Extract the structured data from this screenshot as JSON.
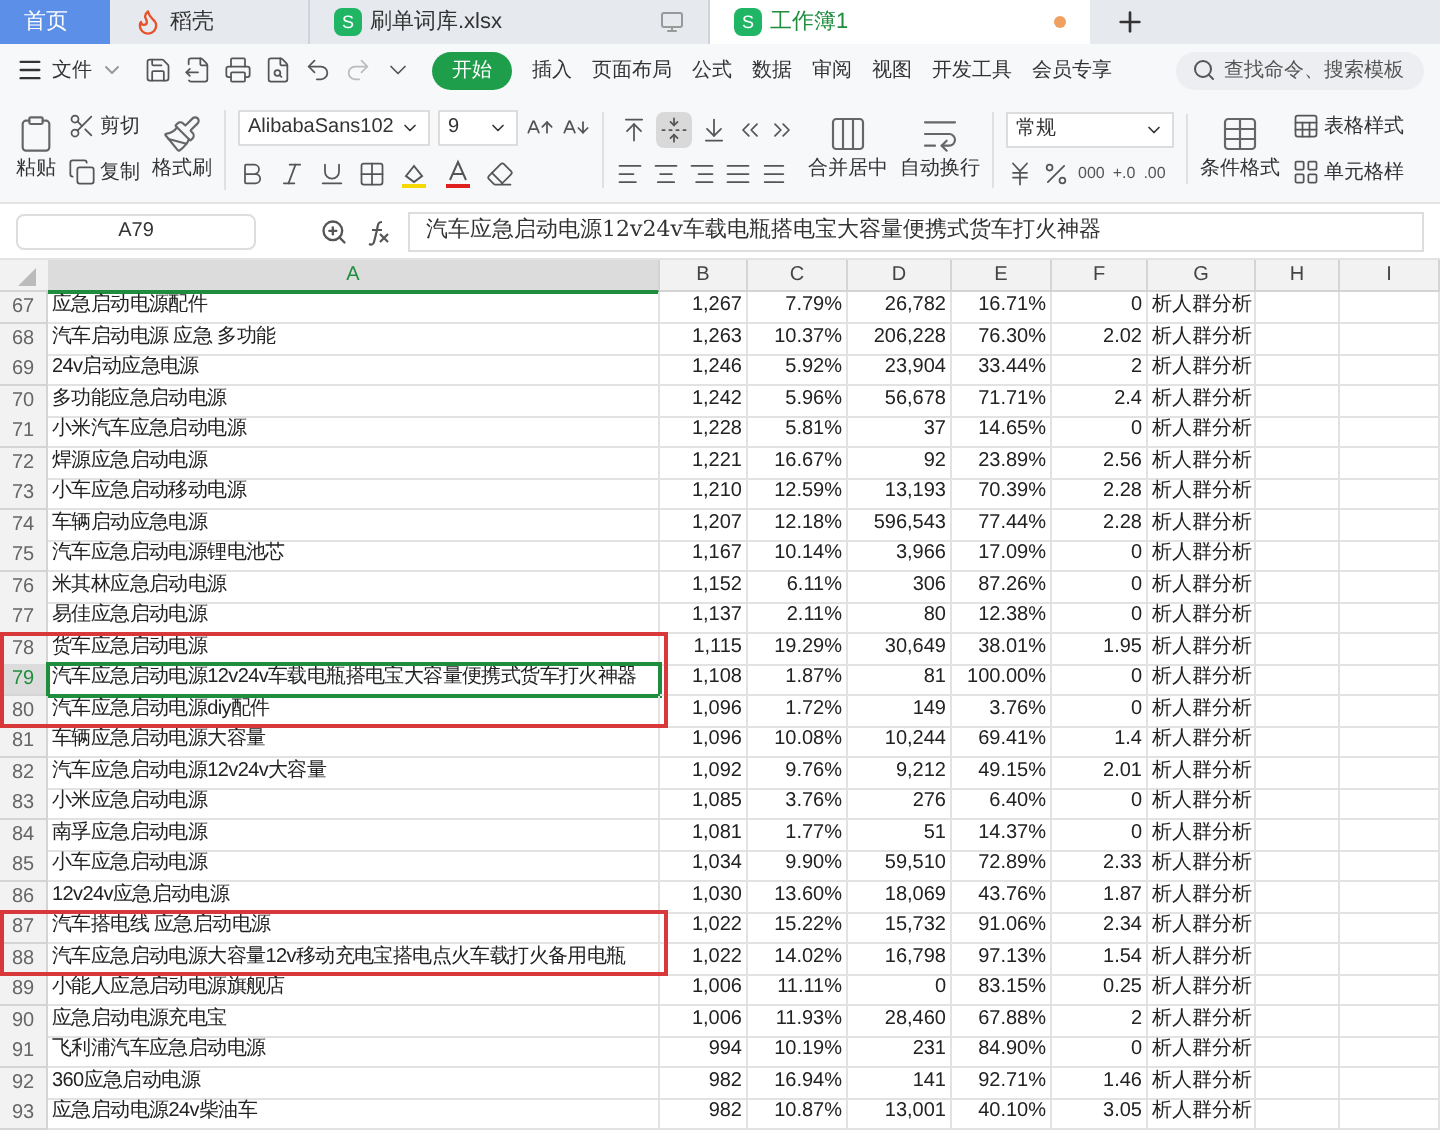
{
  "tabs": [
    {
      "label": "首页",
      "kind": "home",
      "selected": false
    },
    {
      "label": "稻壳",
      "kind": "docer",
      "selected": false
    },
    {
      "label": "刷单词库.xlsx",
      "kind": "sheet",
      "logo": "S",
      "selected": false,
      "unsaved": false
    },
    {
      "label": "工作簿1",
      "kind": "sheet",
      "logo": "S",
      "selected": true,
      "unsaved": true
    }
  ],
  "menu": {
    "file": "文件",
    "items": [
      {
        "label": "开始",
        "selected": true
      },
      {
        "label": "插入",
        "selected": false
      },
      {
        "label": "页面布局",
        "selected": false
      },
      {
        "label": "公式",
        "selected": false
      },
      {
        "label": "数据",
        "selected": false
      },
      {
        "label": "审阅",
        "selected": false
      },
      {
        "label": "视图",
        "selected": false
      },
      {
        "label": "开发工具",
        "selected": false
      },
      {
        "label": "会员专享",
        "selected": false
      }
    ],
    "search": {
      "placeholder": "查找命令、搜索模板"
    }
  },
  "ribbon": {
    "paste": "粘贴",
    "cut": "剪切",
    "copy": "复制",
    "painter": "格式刷",
    "font": "AlibabaSans102",
    "size": "9",
    "align_buttons": [
      {
        "kind": "top",
        "selected": false
      },
      {
        "kind": "middle",
        "selected": true
      },
      {
        "kind": "bottom",
        "selected": false
      }
    ],
    "merge": "合并居中",
    "wrap": "自动换行",
    "number_format": "常规",
    "number_buttons": [
      "000",
      "+.0",
      ".00"
    ],
    "conditional": "条件格式",
    "table_style": "表格样式",
    "cell_style": "单元格样"
  },
  "formula_bar": {
    "cell": "A79",
    "content": "汽车应急启动电源12v24v车载电瓶搭电宝大容量便携式货车打火神器"
  },
  "sheet": {
    "columns": [
      {
        "label": "A",
        "selected": true
      },
      {
        "label": "B",
        "selected": false
      },
      {
        "label": "C",
        "selected": false
      },
      {
        "label": "D",
        "selected": false
      },
      {
        "label": "E",
        "selected": false
      },
      {
        "label": "F",
        "selected": false
      },
      {
        "label": "G",
        "selected": false
      },
      {
        "label": "H",
        "selected": false
      },
      {
        "label": "I",
        "selected": false
      }
    ],
    "rows": [
      {
        "number": "67",
        "selected": false,
        "boxed": false,
        "cells": [
          "应急启动电源配件",
          "1,267",
          "7.79%",
          "26,782",
          "16.71%",
          "0",
          "析人群分析"
        ]
      },
      {
        "number": "68",
        "selected": false,
        "boxed": false,
        "cells": [
          "汽车启动电源 应急 多功能",
          "1,263",
          "10.37%",
          "206,228",
          "76.30%",
          "2.02",
          "析人群分析"
        ]
      },
      {
        "number": "69",
        "selected": false,
        "boxed": false,
        "cells": [
          "24v启动应急电源",
          "1,246",
          "5.92%",
          "23,904",
          "33.44%",
          "2",
          "析人群分析"
        ]
      },
      {
        "number": "70",
        "selected": false,
        "boxed": false,
        "cells": [
          "多功能应急启动电源",
          "1,242",
          "5.96%",
          "56,678",
          "71.71%",
          "2.4",
          "析人群分析"
        ]
      },
      {
        "number": "71",
        "selected": false,
        "boxed": false,
        "cells": [
          "小米汽车应急启动电源",
          "1,228",
          "5.81%",
          "37",
          "14.65%",
          "0",
          "析人群分析"
        ]
      },
      {
        "number": "72",
        "selected": false,
        "boxed": false,
        "cells": [
          "焊源应急启动电源",
          "1,221",
          "16.67%",
          "92",
          "23.89%",
          "2.56",
          "析人群分析"
        ]
      },
      {
        "number": "73",
        "selected": false,
        "boxed": false,
        "cells": [
          "小车应急启动移动电源",
          "1,210",
          "12.59%",
          "13,193",
          "70.39%",
          "2.28",
          "析人群分析"
        ]
      },
      {
        "number": "74",
        "selected": false,
        "boxed": false,
        "cells": [
          "车辆启动应急电源",
          "1,207",
          "12.18%",
          "596,543",
          "77.44%",
          "2.28",
          "析人群分析"
        ]
      },
      {
        "number": "75",
        "selected": false,
        "boxed": false,
        "cells": [
          "汽车应急启动电源锂电池芯",
          "1,167",
          "10.14%",
          "3,966",
          "17.09%",
          "0",
          "析人群分析"
        ]
      },
      {
        "number": "76",
        "selected": false,
        "boxed": false,
        "cells": [
          "米其林应急启动电源",
          "1,152",
          "6.11%",
          "306",
          "87.26%",
          "0",
          "析人群分析"
        ]
      },
      {
        "number": "77",
        "selected": false,
        "boxed": false,
        "cells": [
          "易佳应急启动电源",
          "1,137",
          "2.11%",
          "80",
          "12.38%",
          "0",
          "析人群分析"
        ]
      },
      {
        "number": "78",
        "selected": false,
        "boxed": true,
        "cells": [
          "货车应急启动电源",
          "1,115",
          "19.29%",
          "30,649",
          "38.01%",
          "1.95",
          "析人群分析"
        ]
      },
      {
        "number": "79",
        "selected": true,
        "boxed": true,
        "cells": [
          "汽车应急启动电源12v24v车载电瓶搭电宝大容量便携式货车打火神器",
          "1,108",
          "1.87%",
          "81",
          "100.00%",
          "0",
          "析人群分析"
        ]
      },
      {
        "number": "80",
        "selected": false,
        "boxed": true,
        "cells": [
          "汽车应急启动电源diy配件",
          "1,096",
          "1.72%",
          "149",
          "3.76%",
          "0",
          "析人群分析"
        ]
      },
      {
        "number": "81",
        "selected": false,
        "boxed": false,
        "cells": [
          "车辆应急启动电源大容量",
          "1,096",
          "10.08%",
          "10,244",
          "69.41%",
          "1.4",
          "析人群分析"
        ]
      },
      {
        "number": "82",
        "selected": false,
        "boxed": false,
        "cells": [
          "汽车应急启动电源12v24v大容量",
          "1,092",
          "9.76%",
          "9,212",
          "49.15%",
          "2.01",
          "析人群分析"
        ]
      },
      {
        "number": "83",
        "selected": false,
        "boxed": false,
        "cells": [
          "小米应急启动电源",
          "1,085",
          "3.76%",
          "276",
          "6.40%",
          "0",
          "析人群分析"
        ]
      },
      {
        "number": "84",
        "selected": false,
        "boxed": false,
        "cells": [
          "南孚应急启动电源",
          "1,081",
          "1.77%",
          "51",
          "14.37%",
          "0",
          "析人群分析"
        ]
      },
      {
        "number": "85",
        "selected": false,
        "boxed": false,
        "cells": [
          "小车应急启动电源",
          "1,034",
          "9.90%",
          "59,510",
          "72.89%",
          "2.33",
          "析人群分析"
        ]
      },
      {
        "number": "86",
        "selected": false,
        "boxed": false,
        "cells": [
          "12v24v应急启动电源",
          "1,030",
          "13.60%",
          "18,069",
          "43.76%",
          "1.87",
          "析人群分析"
        ]
      },
      {
        "number": "87",
        "selected": false,
        "boxed": true,
        "cells": [
          "汽车搭电线 应急启动电源",
          "1,022",
          "15.22%",
          "15,732",
          "91.06%",
          "2.34",
          "析人群分析"
        ]
      },
      {
        "number": "88",
        "selected": false,
        "boxed": true,
        "cells": [
          "汽车应急启动电源大容量12v移动充电宝搭电点火车载打火备用电瓶",
          "1,022",
          "14.02%",
          "16,798",
          "97.13%",
          "1.54",
          "析人群分析"
        ]
      },
      {
        "number": "89",
        "selected": false,
        "boxed": false,
        "cells": [
          "小能人应急启动电源旗舰店",
          "1,006",
          "11.11%",
          "0",
          "83.15%",
          "0.25",
          "析人群分析"
        ]
      },
      {
        "number": "90",
        "selected": false,
        "boxed": false,
        "cells": [
          "应急启动电源充电宝",
          "1,006",
          "11.93%",
          "28,460",
          "67.88%",
          "2",
          "析人群分析"
        ]
      },
      {
        "number": "91",
        "selected": false,
        "boxed": false,
        "cells": [
          "飞利浦汽车应急启动电源",
          "994",
          "10.19%",
          "231",
          "84.90%",
          "0",
          "析人群分析"
        ]
      },
      {
        "number": "92",
        "selected": false,
        "boxed": false,
        "cells": [
          "360应急启动电源",
          "982",
          "16.94%",
          "141",
          "92.71%",
          "1.46",
          "析人群分析"
        ]
      },
      {
        "number": "93",
        "selected": false,
        "boxed": false,
        "cells": [
          "应急启动电源24v柴油车",
          "982",
          "10.87%",
          "13,001",
          "40.10%",
          "3.05",
          "析人群分析"
        ]
      }
    ]
  }
}
